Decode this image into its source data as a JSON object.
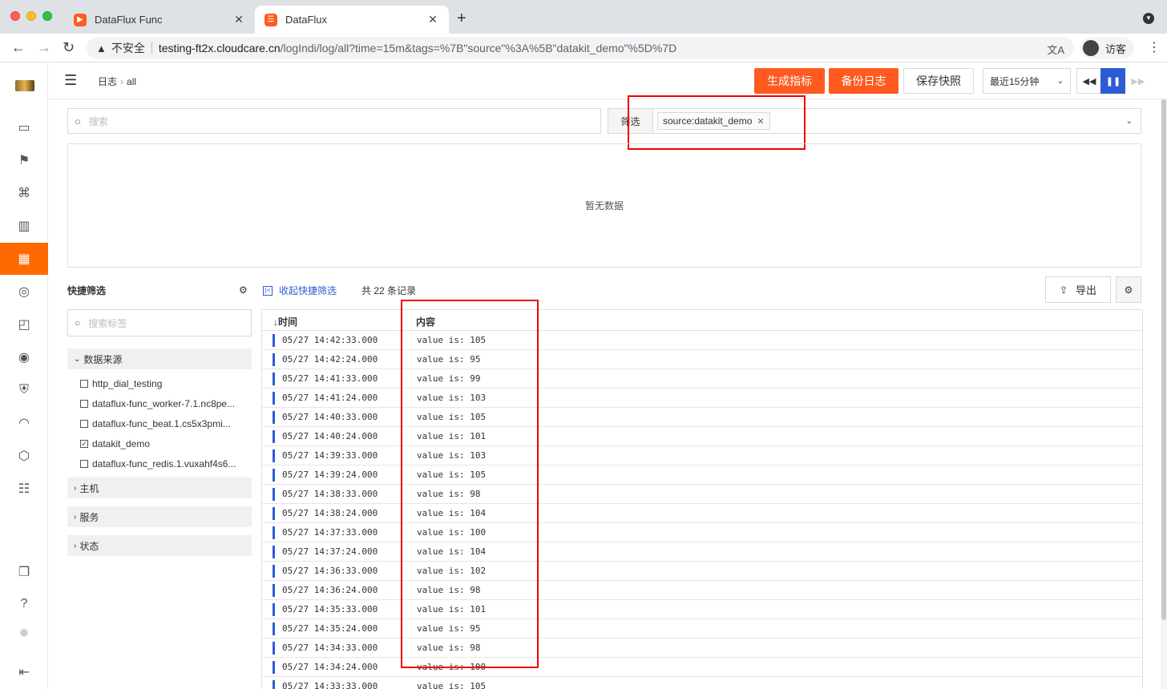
{
  "browser": {
    "tabs": [
      {
        "title": "DataFlux Func",
        "close": "✕"
      },
      {
        "title": "DataFlux",
        "close": "✕"
      }
    ],
    "new_tab": "+",
    "insecure_label": "不安全",
    "url_host": "testing-ft2x.cloudcare.cn",
    "url_path": "/logIndi/log/all?time=15m&tags=%7B\"source\"%3A%5B\"datakit_demo\"%5D%7D",
    "profile_label": "访客"
  },
  "header": {
    "breadcrumb": [
      "日志",
      "all"
    ],
    "buttons": {
      "generate_metric": "生成指标",
      "backup_logs": "备份日志",
      "save_snapshot": "保存快照"
    },
    "time_range": "最近15分钟"
  },
  "search": {
    "placeholder": "搜索"
  },
  "filter": {
    "label": "筛选",
    "tag": "source:datakit_demo"
  },
  "chart": {
    "empty_text": "暂无数据"
  },
  "quick_filter": {
    "title": "快捷筛选",
    "search_placeholder": "搜索标签",
    "groups": [
      {
        "label": "数据来源",
        "expanded": true
      },
      {
        "label": "主机",
        "expanded": false
      },
      {
        "label": "服务",
        "expanded": false
      },
      {
        "label": "状态",
        "expanded": false
      }
    ],
    "sources": [
      {
        "label": "http_dial_testing",
        "checked": false
      },
      {
        "label": "dataflux-func_worker-7.1.nc8pe...",
        "checked": false
      },
      {
        "label": "dataflux-func_beat.1.cs5x3pmi...",
        "checked": false
      },
      {
        "label": "datakit_demo",
        "checked": true
      },
      {
        "label": "dataflux-func_redis.1.vuxahf4s6...",
        "checked": false
      }
    ]
  },
  "toolbar": {
    "collapse_label": "收起快捷筛选",
    "record_count": "共 22 条记录",
    "export_label": "导出"
  },
  "table": {
    "columns": [
      "时间",
      "内容"
    ],
    "rows": [
      {
        "time": "05/27 14:42:33.000",
        "content": "value is: 105"
      },
      {
        "time": "05/27 14:42:24.000",
        "content": "value is: 95"
      },
      {
        "time": "05/27 14:41:33.000",
        "content": "value is: 99"
      },
      {
        "time": "05/27 14:41:24.000",
        "content": "value is: 103"
      },
      {
        "time": "05/27 14:40:33.000",
        "content": "value is: 105"
      },
      {
        "time": "05/27 14:40:24.000",
        "content": "value is: 101"
      },
      {
        "time": "05/27 14:39:33.000",
        "content": "value is: 103"
      },
      {
        "time": "05/27 14:39:24.000",
        "content": "value is: 105"
      },
      {
        "time": "05/27 14:38:33.000",
        "content": "value is: 98"
      },
      {
        "time": "05/27 14:38:24.000",
        "content": "value is: 104"
      },
      {
        "time": "05/27 14:37:33.000",
        "content": "value is: 100"
      },
      {
        "time": "05/27 14:37:24.000",
        "content": "value is: 104"
      },
      {
        "time": "05/27 14:36:33.000",
        "content": "value is: 102"
      },
      {
        "time": "05/27 14:36:24.000",
        "content": "value is: 98"
      },
      {
        "time": "05/27 14:35:33.000",
        "content": "value is: 101"
      },
      {
        "time": "05/27 14:35:24.000",
        "content": "value is: 95"
      },
      {
        "time": "05/27 14:34:33.000",
        "content": "value is: 98"
      },
      {
        "time": "05/27 14:34:24.000",
        "content": "value is: 100"
      },
      {
        "time": "05/27 14:33:33.000",
        "content": "value is: 105"
      }
    ]
  },
  "colors": {
    "accent": "#ff5a1f",
    "primary": "#2d5bd6",
    "highlight": "#e00000"
  }
}
